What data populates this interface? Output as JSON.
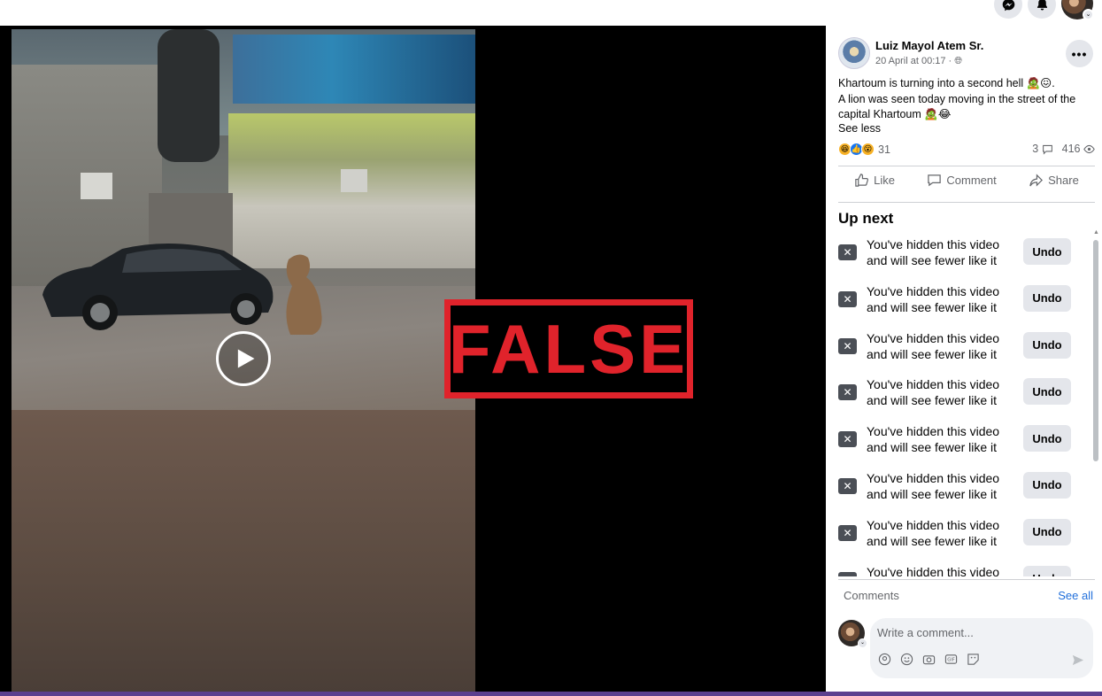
{
  "post": {
    "author": "Luiz Mayol Atem Sr.",
    "time": "20 April at 00:17 · ",
    "text_lines": [
      "Khartoum is turning into a second hell 🧟😖.",
      "A lion was seen today moving in the street of the",
      "capital Khartoum 🧟😂"
    ],
    "see_less": "See less",
    "reaction_count": "31",
    "comments_count": "3",
    "views_count": "416",
    "actions": {
      "like": "Like",
      "comment": "Comment",
      "share": "Share"
    }
  },
  "stamp": {
    "label": "FALSE",
    "color": "#e0232b"
  },
  "up_next": {
    "title": "Up next",
    "items": [
      {
        "text": "You've hidden this video and will see fewer like it",
        "button": "Undo"
      },
      {
        "text": "You've hidden this video and will see fewer like it",
        "button": "Undo"
      },
      {
        "text": "You've hidden this video and will see fewer like it",
        "button": "Undo"
      },
      {
        "text": "You've hidden this video and will see fewer like it",
        "button": "Undo"
      },
      {
        "text": "You've hidden this video and will see fewer like it",
        "button": "Undo"
      },
      {
        "text": "You've hidden this video and will see fewer like it",
        "button": "Undo"
      },
      {
        "text": "You've hidden this video and will see fewer like it",
        "button": "Undo"
      },
      {
        "text": "You've hidden this video",
        "button": "Undo"
      }
    ]
  },
  "comments": {
    "label": "Comments",
    "see_all": "See all",
    "placeholder": "Write a comment..."
  },
  "icons": {
    "top": [
      "messenger-icon",
      "notifications-bell-icon",
      "account-avatar"
    ],
    "comment_tools": [
      "avatar-sticker-icon",
      "emoji-icon",
      "camera-icon",
      "gif-icon",
      "sticker-icon"
    ]
  },
  "colors": {
    "accent": "#1877f2",
    "link": "#216fdb",
    "panel_bg": "#ffffff",
    "video_bg": "#000000",
    "bottom_bar": "#5b3f8f"
  }
}
